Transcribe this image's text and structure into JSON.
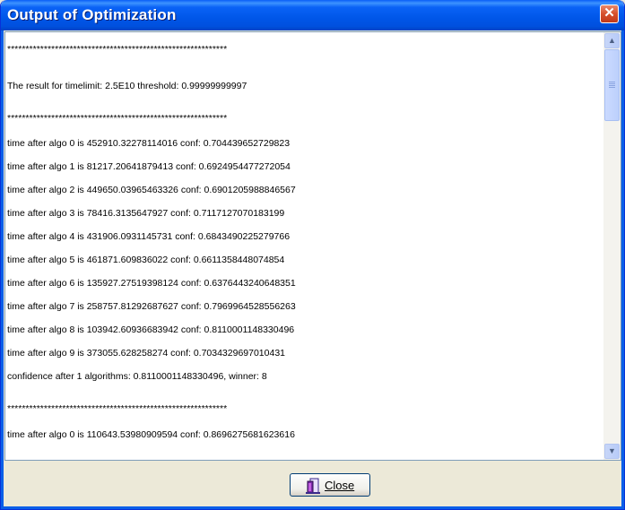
{
  "window": {
    "title": "Output of Optimization",
    "close_glyph": "✕"
  },
  "output_lines": [
    "************************************************************",
    "The result for timelimit: 2.5E10 threshold: 0.99999999997",
    "************************************************************",
    "time after algo 0 is 452910.32278114016 conf: 0.704439652729823",
    "time after algo 1 is 81217.20641879413 conf: 0.6924954477272054",
    "time after algo 2 is 449650.03965463326 conf: 0.6901205988846567",
    "time after algo 3 is 78416.3135647927 conf: 0.7117127070183199",
    "time after algo 4 is 431906.0931145731 conf: 0.6843490225279766",
    "time after algo 5 is 461871.609836022 conf: 0.6611358448074854",
    "time after algo 6 is 135927.27519398124 conf: 0.6376443240648351",
    "time after algo 7 is 258757.81292687627 conf: 0.7969964528556263",
    "time after algo 8 is 103942.60936683942 conf: 0.8110001148330496",
    "time after algo 9 is 373055.628258274 conf: 0.7034329697010431",
    "confidence after 1 algorithms: 0.8110001148330496, winner: 8",
    "************************************************************",
    "time after algo 0 is 110643.53980909594 conf: 0.8696275681623616"
  ],
  "footer": {
    "close_label": "Close",
    "close_icon": "door-exit-icon"
  }
}
